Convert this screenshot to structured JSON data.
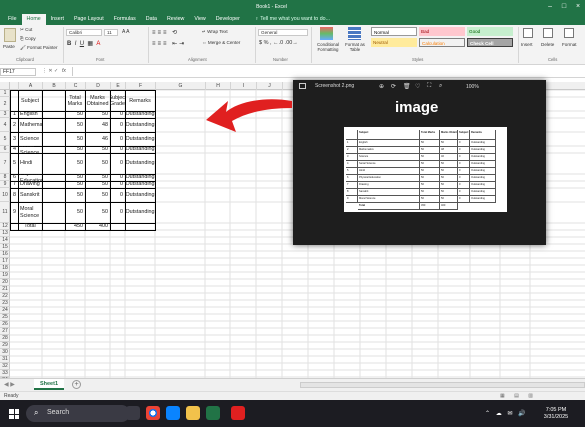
{
  "window": {
    "title": "Book1 - Excel",
    "file_tab": "File"
  },
  "ribbon_tabs": [
    "Home",
    "Insert",
    "Page Layout",
    "Formulas",
    "Data",
    "Review",
    "View",
    "Developer"
  ],
  "tell_me": "Tell me what you want to do...",
  "ribbon": {
    "paste": "Paste",
    "cut": "Cut",
    "copy": "Copy",
    "format_painter": "Format Painter",
    "clipboard": "Clipboard",
    "font_name": "Calibri",
    "font_size": "11",
    "font_group": "Font",
    "wrap_text": "Wrap Text",
    "merge_center": "Merge & Center",
    "alignment": "Alignment",
    "number_format": "General",
    "number": "Number",
    "conditional_formatting": "Conditional Formatting",
    "format_as_table": "Format as Table",
    "styles_group": "Styles",
    "styles": [
      {
        "name": "Normal",
        "bg": "#ffffff",
        "fg": "#000000"
      },
      {
        "name": "Bad",
        "bg": "#ffc7ce",
        "fg": "#9c0006"
      },
      {
        "name": "Good",
        "bg": "#c6efce",
        "fg": "#006100"
      },
      {
        "name": "Neutral",
        "bg": "#ffeb9c",
        "fg": "#9c5700"
      },
      {
        "name": "Calculation",
        "bg": "#f2f2f2",
        "fg": "#fa7d00"
      },
      {
        "name": "Check Cell",
        "bg": "#a5a5a5",
        "fg": "#ffffff"
      }
    ],
    "insert": "Insert",
    "delete": "Delete",
    "format": "Format",
    "cells": "Cells"
  },
  "formula_bar": {
    "name_box": "FF17",
    "fx": "fx",
    "value": ""
  },
  "columns": [
    "A",
    "B",
    "C",
    "D",
    "E",
    "F",
    "G",
    "H",
    "I",
    "J",
    "K",
    "L",
    "M",
    "N",
    "O",
    "P",
    "Q",
    "R",
    "S"
  ],
  "rows": [
    "1",
    "2",
    "3",
    "4",
    "5",
    "6",
    "7",
    "8",
    "9",
    "10",
    "11",
    "12",
    "13",
    "14",
    "15",
    "16",
    "17",
    "18",
    "19",
    "20",
    "21",
    "22",
    "23",
    "24",
    "25",
    "26",
    "27",
    "28",
    "29",
    "30",
    "31",
    "32",
    "33",
    "34",
    "35"
  ],
  "table": {
    "headers": [
      "Subject",
      "Total Marks",
      "Marks Obtained",
      "Subject Grade",
      "Remarks"
    ],
    "rows": [
      {
        "n": "1",
        "subject": "English",
        "total": "50",
        "obtained": "50",
        "grade": "0",
        "remarks": "Outstanding"
      },
      {
        "n": "2",
        "subject": "Mathematics",
        "total": "50",
        "obtained": "48",
        "grade": "0",
        "remarks": "Outstanding"
      },
      {
        "n": "3",
        "subject": "Science",
        "total": "50",
        "obtained": "46",
        "grade": "0",
        "remarks": "Outstanding"
      },
      {
        "n": "4",
        "subject": "Serial Science",
        "total": "50",
        "obtained": "50",
        "grade": "0",
        "remarks": "Outstanding"
      },
      {
        "n": "5",
        "subject": "Hindi",
        "total": "50",
        "obtained": "50",
        "grade": "0",
        "remarks": "Outstanding"
      },
      {
        "n": "6",
        "subject": "Physical Education",
        "total": "50",
        "obtained": "50",
        "grade": "0",
        "remarks": "Outstanding"
      },
      {
        "n": "7",
        "subject": "Drawing",
        "total": "50",
        "obtained": "50",
        "grade": "0",
        "remarks": "Outstanding"
      },
      {
        "n": "8",
        "subject": "Sanskrit",
        "total": "50",
        "obtained": "50",
        "grade": "0",
        "remarks": "Outstanding"
      },
      {
        "n": "9",
        "subject": "Moral Science",
        "total": "50",
        "obtained": "50",
        "grade": "0",
        "remarks": "Outstanding"
      }
    ],
    "total_label": "Total",
    "total_marks": "450",
    "total_obtained": "400"
  },
  "sheet_tab": "Sheet1",
  "status": "Ready",
  "viewer": {
    "title": "Screenshot 2.png",
    "zoom": "100%",
    "caption": "image"
  },
  "annotation_color": "#e02020",
  "taskbar": {
    "search": "Search",
    "time": "7:05 PM",
    "date": "3/31/2025"
  }
}
